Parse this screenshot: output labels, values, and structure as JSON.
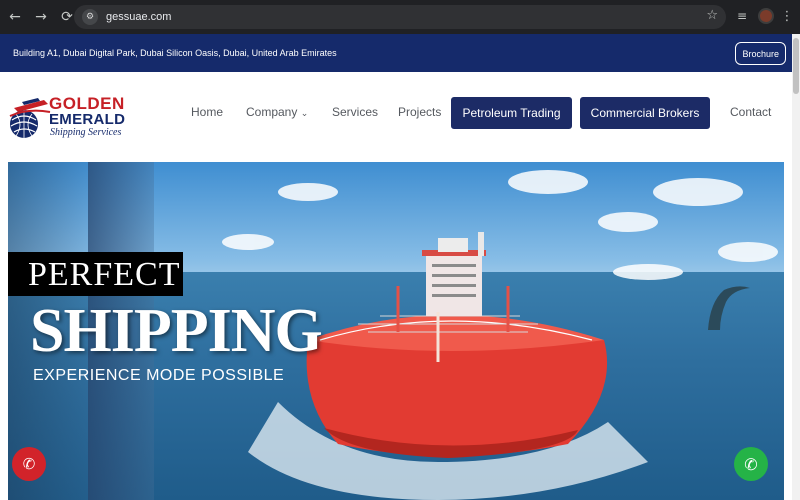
{
  "browser": {
    "url": "gessuae.com",
    "back_icon": "←",
    "forward_icon": "→",
    "reload_icon": "⟳",
    "site_info_icon": "⚙",
    "bookmark_icon": "☆",
    "media_icon": "≡",
    "menu_icon": "⋮"
  },
  "topbar": {
    "address": "Building A1, Dubai Digital Park, Dubai Silicon Oasis, Dubai, United Arab Emirates",
    "brochure_label": "Brochure"
  },
  "logo": {
    "line1": "GOLDEN",
    "line2": "EMERALD",
    "line3": "Shipping Services"
  },
  "nav": {
    "home": "Home",
    "company": "Company",
    "company_caret": "⌄",
    "services": "Services",
    "projects": "Projects",
    "petroleum": "Petroleum Trading",
    "brokers": "Commercial Brokers",
    "contact": "Contact"
  },
  "hero": {
    "line1": "PERFECT",
    "line2": "SHIPPING",
    "line3": "EXPERIENCE  MODE POSSIBLE"
  },
  "floating": {
    "call_icon": "✆",
    "whatsapp_icon": "✆"
  },
  "colors": {
    "topbar": "#152a6b",
    "nav_pill": "#1c2b66",
    "logo_red": "#c62026",
    "call_red": "#d2232a",
    "whatsapp_green": "#25b347"
  }
}
